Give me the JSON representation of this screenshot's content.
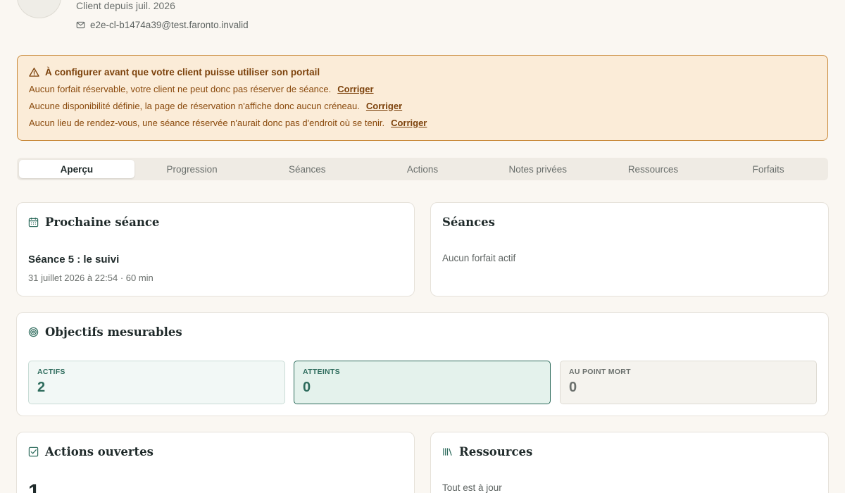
{
  "client": {
    "since": "Client depuis juil. 2026",
    "email": "e2e-cl-b1474a39@test.faronto.invalid"
  },
  "warning": {
    "title": "À configurer avant que votre client puisse utiliser son portail",
    "items": [
      {
        "text": "Aucun forfait réservable, votre client ne peut donc pas réserver de séance.",
        "fix": "Corriger"
      },
      {
        "text": "Aucune disponibilité définie, la page de réservation n'affiche donc aucun créneau.",
        "fix": "Corriger"
      },
      {
        "text": "Aucun lieu de rendez-vous, une séance réservée n'aurait donc pas d'endroit où se tenir.",
        "fix": "Corriger"
      }
    ]
  },
  "tabs": [
    {
      "label": "Aperçu",
      "active": true
    },
    {
      "label": "Progression"
    },
    {
      "label": "Séances"
    },
    {
      "label": "Actions"
    },
    {
      "label": "Notes privées"
    },
    {
      "label": "Ressources"
    },
    {
      "label": "Forfaits"
    }
  ],
  "next_session": {
    "title": "Prochaine séance",
    "name": "Séance 5 : le suivi",
    "meta": "31 juillet 2026 à 22:54 · 60 min"
  },
  "sessions": {
    "title": "Séances",
    "empty": "Aucun forfait actif"
  },
  "goals": {
    "title": "Objectifs mesurables",
    "active": {
      "label": "ACTIFS",
      "value": "2"
    },
    "reached": {
      "label": "ATTEINTS",
      "value": "0"
    },
    "stalled": {
      "label": "AU POINT MORT",
      "value": "0"
    }
  },
  "actions": {
    "title": "Actions ouvertes",
    "count": "1"
  },
  "resources": {
    "title": "Ressources",
    "status": "Tout est à jour"
  },
  "colors": {
    "accent": "#2d6b5c",
    "warning_bg": "#fbecd8",
    "warning_border": "#c98a3c",
    "page_bg": "#faf7f2"
  }
}
